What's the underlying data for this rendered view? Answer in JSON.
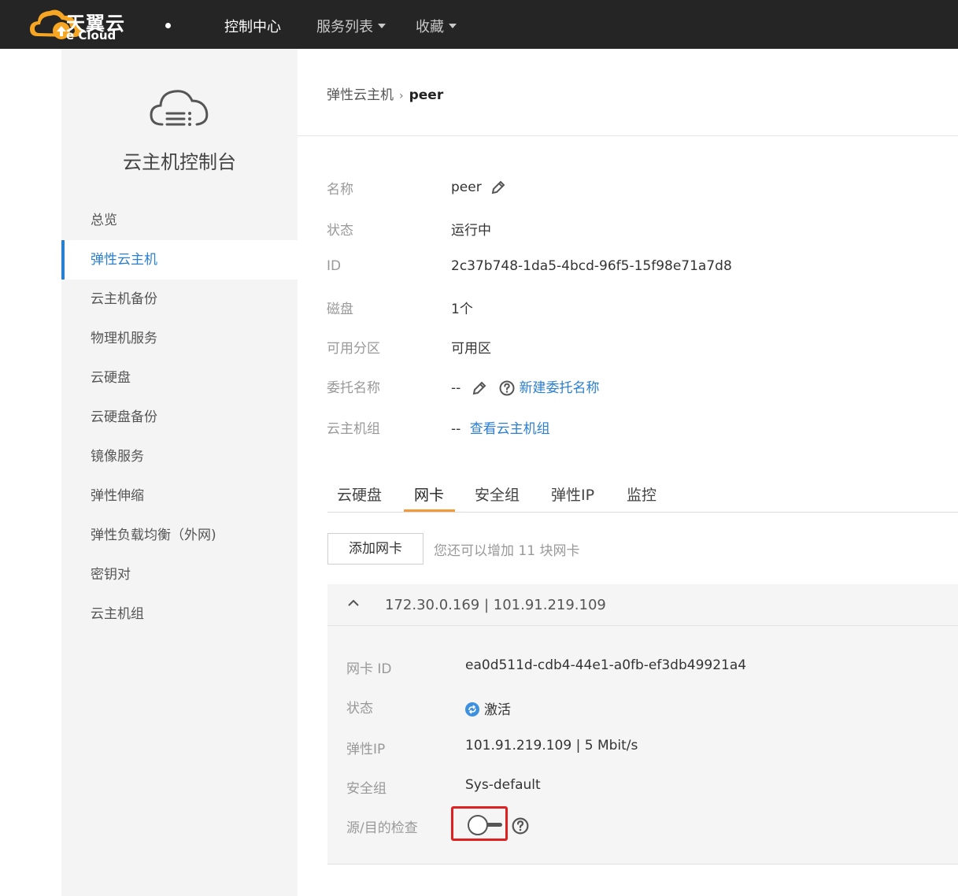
{
  "topbar": {
    "logo_cn": "天翼云",
    "logo_en": "e Cloud",
    "nav": [
      "控制中心",
      "服务列表",
      "收藏"
    ]
  },
  "sidebar": {
    "title": "云主机控制台",
    "items": [
      "总览",
      "弹性云主机",
      "云主机备份",
      "物理机服务",
      "云硬盘",
      "云硬盘备份",
      "镜像服务",
      "弹性伸缩",
      "弹性负载均衡（外网)",
      "密钥对",
      "云主机组"
    ],
    "active_index": 1
  },
  "breadcrumb": {
    "parent": "弹性云主机",
    "separator": "›",
    "current": "peer"
  },
  "info": {
    "name_label": "名称",
    "name_value": "peer",
    "status_label": "状态",
    "status_value": "运行中",
    "id_label": "ID",
    "id_value": "2c37b748-1da5-4bcd-96f5-15f98e71a7d8",
    "disk_label": "磁盘",
    "disk_value": "1个",
    "zone_label": "可用分区",
    "zone_value": "可用区",
    "agency_label": "委托名称",
    "agency_value": "--",
    "agency_link": "新建委托名称",
    "group_label": "云主机组",
    "group_value": "--",
    "group_link": "查看云主机组"
  },
  "tabs": [
    "云硬盘",
    "网卡",
    "安全组",
    "弹性IP",
    "监控"
  ],
  "active_tab": 1,
  "nic_toolbar": {
    "add_button": "添加网卡",
    "hint": "您还可以增加 11 块网卡"
  },
  "nic": {
    "title": "172.30.0.169 | 101.91.219.109",
    "id_label": "网卡 ID",
    "id_value": "ea0d511d-cdb4-44e1-a0fb-ef3db49921a4",
    "status_label": "状态",
    "status_value": "激活",
    "eip_label": "弹性IP",
    "eip_value": "101.91.219.109 | 5 Mbit/s",
    "sg_label": "安全组",
    "sg_value": "Sys-default",
    "check_label": "源/目的检查",
    "check_enabled": false
  },
  "colors": {
    "accent": "#2b7fd0",
    "tab_underline": "#f2993a",
    "topbar": "#252525",
    "highlight_box": "#e02020"
  }
}
